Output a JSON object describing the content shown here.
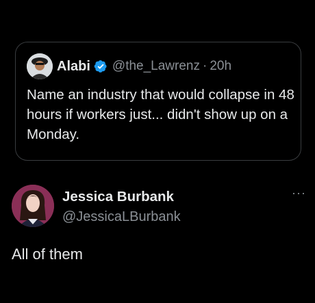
{
  "quoted_post": {
    "author_name": "Alabi",
    "author_handle": "@the_Lawrenz",
    "separator": "·",
    "time": "20h",
    "text": "Name an industry that would collapse in 48 hours if workers just... didn't show up on a Monday.",
    "verified_color": "#1d9bf0"
  },
  "reply": {
    "author_name": "Jessica Burbank",
    "author_handle": "@JessicaLBurbank",
    "more_label": "···",
    "text": "All of them"
  }
}
